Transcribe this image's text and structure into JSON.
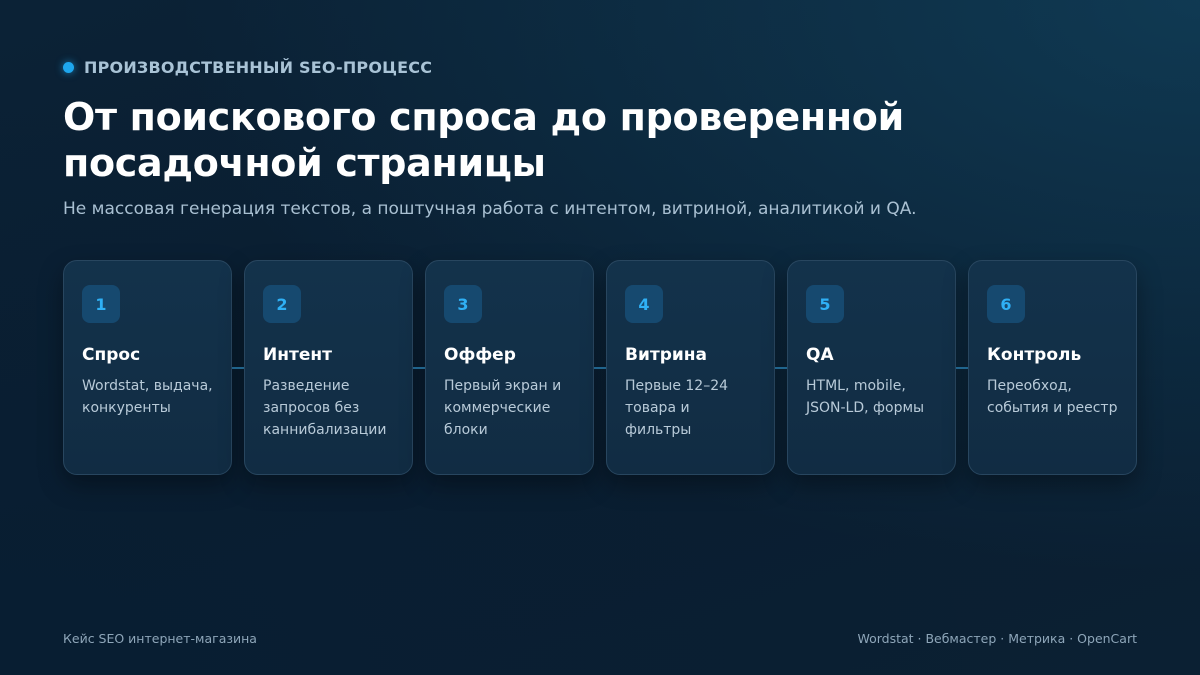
{
  "header": {
    "eyebrow": "ПРОИЗВОДСТВЕННЫЙ SEO-ПРОЦЕСС",
    "title": "От поискового спроса до проверенной посадочной страницы",
    "subtitle": "Не массовая генерация текстов, а поштучная работа с интентом, витриной, аналитикой и QA."
  },
  "steps": [
    {
      "num": "1",
      "title": "Спрос",
      "desc": "Wordstat, выдача, конкуренты"
    },
    {
      "num": "2",
      "title": "Интент",
      "desc": "Разведение запросов без каннибализации"
    },
    {
      "num": "3",
      "title": "Оффер",
      "desc": "Первый экран и коммерческие блоки"
    },
    {
      "num": "4",
      "title": "Витрина",
      "desc": "Первые 12–24 товара и фильтры"
    },
    {
      "num": "5",
      "title": "QA",
      "desc": "HTML, mobile, JSON-LD, формы"
    },
    {
      "num": "6",
      "title": "Контроль",
      "desc": "Переобход, события и реестр"
    }
  ],
  "footer": {
    "left": "Кейс SEO интернет-магазина",
    "right": "Wordstat · Вебмастер · Метрика · OpenCart"
  },
  "colors": {
    "accent": "#1ea7ee",
    "background": "#0b2236",
    "card": "#13324b"
  }
}
